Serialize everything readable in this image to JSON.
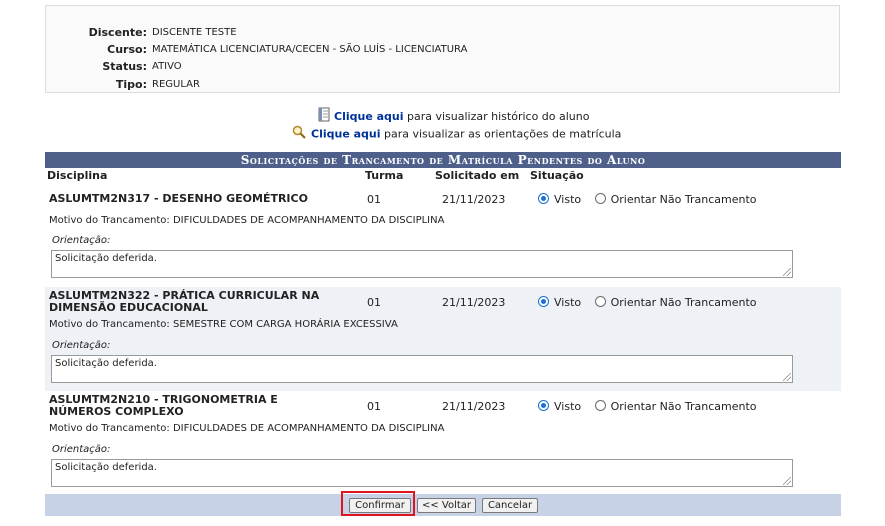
{
  "student": {
    "discente_label": "Discente:",
    "discente_value": "DISCENTE TESTE",
    "curso_label": "Curso:",
    "curso_value": "MATEMÁTICA LICENCIATURA/CECEN - SÃO LUÍS - LICENCIATURA",
    "status_label": "Status:",
    "status_value": "ATIVO",
    "tipo_label": "Tipo:",
    "tipo_value": "REGULAR"
  },
  "links": {
    "historico_link": "Clique aqui",
    "historico_text": " para visualizar histórico do aluno",
    "orientacoes_link": "Clique aqui",
    "orientacoes_text": " para visualizar as orientações de matrícula"
  },
  "panel": {
    "title": "Solicitações de Trancamento de Matrícula Pendentes do Aluno",
    "columns": [
      "Disciplina",
      "Turma",
      "Solicitado em",
      "Situação"
    ],
    "option_visto": "Visto",
    "option_orientar": "Orientar Não Trancamento",
    "motivo_prefix": "Motivo do Trancamento: ",
    "orientacao_label": "Orientação:",
    "rows": [
      {
        "disciplina": "ASLUMTM2N317 - DESENHO GEOMÉTRICO",
        "turma": "01",
        "data": "21/11/2023",
        "motivo": "DIFICULDADES DE ACOMPANHAMENTO DA DISCIPLINA",
        "orientacao": "Solicitação deferida.",
        "situacao": "Visto"
      },
      {
        "disciplina": "ASLUMTM2N322 - PRÁTICA CURRICULAR NA DIMENSÃO EDUCACIONAL",
        "turma": "01",
        "data": "21/11/2023",
        "motivo": "SEMESTRE COM CARGA HORÁRIA EXCESSIVA",
        "orientacao": "Solicitação deferida.",
        "situacao": "Visto"
      },
      {
        "disciplina": "ASLUMTM2N210 - TRIGONOMETRIA E NÚMEROS COMPLEXO",
        "turma": "01",
        "data": "21/11/2023",
        "motivo": "DIFICULDADES DE ACOMPANHAMENTO DA DISCIPLINA",
        "orientacao": "Solicitação deferida.",
        "situacao": "Visto"
      }
    ]
  },
  "buttons": {
    "confirmar": "Confirmar",
    "voltar": "<< Voltar",
    "cancelar": "Cancelar"
  },
  "colors": {
    "header_bg": "#4e5f8a",
    "footer_bg": "#c7d2e6",
    "row_alt_bg": "#eef1f6",
    "link_color": "#003399",
    "highlight_border": "#e0141e"
  }
}
